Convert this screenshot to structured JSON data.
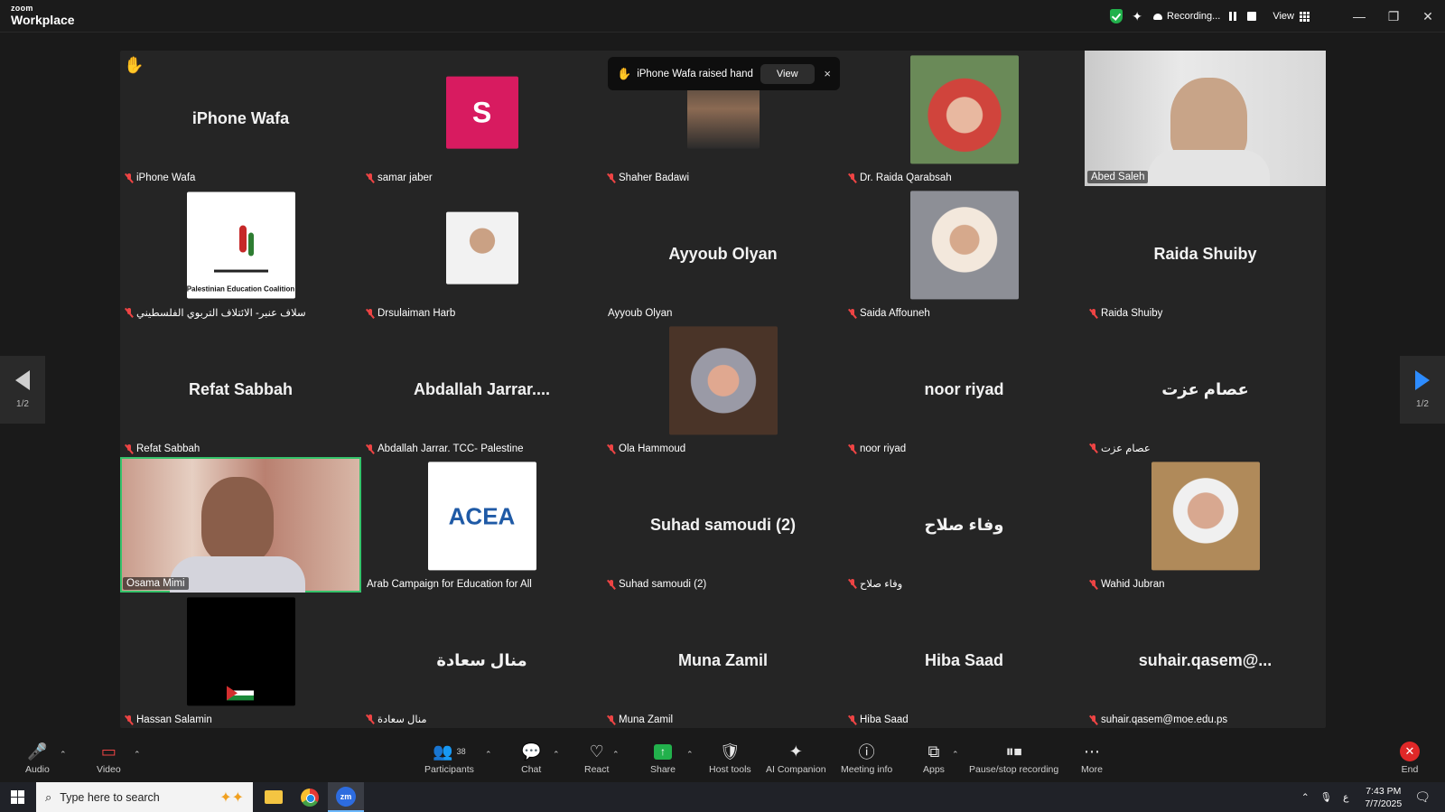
{
  "app": {
    "brand_small": "zoom",
    "brand_big": "Workplace"
  },
  "topbar": {
    "recording_label": "Recording...",
    "view_label": "View"
  },
  "notification": {
    "text": "iPhone Wafa raised hand",
    "view_label": "View",
    "close": "×"
  },
  "paging": {
    "page_left": "1/2",
    "page_right": "1/2"
  },
  "tiles": [
    {
      "big_name": "iPhone Wafa",
      "label": "iPhone Wafa",
      "muted": true,
      "kind": "name",
      "raised_hand": true
    },
    {
      "big_name": "",
      "label": "samar jaber",
      "muted": true,
      "kind": "avatar",
      "avatar_letter": "S"
    },
    {
      "big_name": "",
      "label": "Shaher Badawi",
      "muted": true,
      "kind": "photo"
    },
    {
      "big_name": "",
      "label": "Dr. Raida Qarabsah",
      "muted": true,
      "kind": "photo"
    },
    {
      "big_name": "",
      "label": "Abed Saleh",
      "muted": false,
      "kind": "video"
    },
    {
      "big_name": "",
      "label": "سلاف عنبر- الائتلاف التربوي الفلسطيني",
      "muted": true,
      "kind": "logo",
      "logo_text": "Palestinian Education Coalition"
    },
    {
      "big_name": "",
      "label": "Drsulaiman Harb",
      "muted": true,
      "kind": "photo"
    },
    {
      "big_name": "Ayyoub Olyan",
      "label": "Ayyoub Olyan",
      "muted": false,
      "kind": "name"
    },
    {
      "big_name": "",
      "label": "Saida Affouneh",
      "muted": true,
      "kind": "photo"
    },
    {
      "big_name": "Raida Shuiby",
      "label": "Raida Shuiby",
      "muted": true,
      "kind": "name"
    },
    {
      "big_name": "Refat Sabbah",
      "label": "Refat Sabbah",
      "muted": true,
      "kind": "name"
    },
    {
      "big_name": "Abdallah Jarrar....",
      "label": "Abdallah Jarrar. TCC- Palestine",
      "muted": true,
      "kind": "name"
    },
    {
      "big_name": "",
      "label": "Ola Hammoud",
      "muted": true,
      "kind": "photo"
    },
    {
      "big_name": "noor riyad",
      "label": "noor riyad",
      "muted": true,
      "kind": "name"
    },
    {
      "big_name": "عصام عزت",
      "label": "عصام عزت",
      "muted": true,
      "kind": "name"
    },
    {
      "big_name": "",
      "label": "Osama Mimi",
      "muted": false,
      "kind": "video",
      "active": true
    },
    {
      "big_name": "",
      "label": "Arab Campaign for Education for All",
      "muted": false,
      "kind": "logo",
      "logo_text": "ACEA"
    },
    {
      "big_name": "Suhad samoudi (2)",
      "label": "Suhad samoudi (2)",
      "muted": true,
      "kind": "name"
    },
    {
      "big_name": "وفاء صلاح",
      "label": "وفاء صلاح",
      "muted": true,
      "kind": "name"
    },
    {
      "big_name": "",
      "label": "Wahid Jubran",
      "muted": true,
      "kind": "photo"
    },
    {
      "big_name": "",
      "label": "Hassan Salamin",
      "muted": true,
      "kind": "photo"
    },
    {
      "big_name": "منال سعادة",
      "label": "منال سعادة",
      "muted": true,
      "kind": "name"
    },
    {
      "big_name": "Muna Zamil",
      "label": "Muna Zamil",
      "muted": true,
      "kind": "name"
    },
    {
      "big_name": "Hiba Saad",
      "label": "Hiba Saad",
      "muted": true,
      "kind": "name"
    },
    {
      "big_name": "suhair.qasem@...",
      "label": "suhair.qasem@moe.edu.ps",
      "muted": true,
      "kind": "name"
    }
  ],
  "toolbar": {
    "audio": "Audio",
    "video": "Video",
    "participants": "Participants",
    "participants_count": "38",
    "chat": "Chat",
    "react": "React",
    "share": "Share",
    "host_tools": "Host tools",
    "ai_companion": "AI Companion",
    "meeting_info": "Meeting info",
    "apps": "Apps",
    "pause_stop": "Pause/stop recording",
    "more": "More",
    "end": "End"
  },
  "taskbar": {
    "search_placeholder": "Type here to search",
    "time": "7:43 PM",
    "date": "7/7/2025",
    "lang": "ع"
  },
  "colors": {
    "accent_blue": "#2d8cff",
    "active_green": "#35c36b",
    "avatar_pink": "#d81b60",
    "end_red": "#e02828"
  }
}
